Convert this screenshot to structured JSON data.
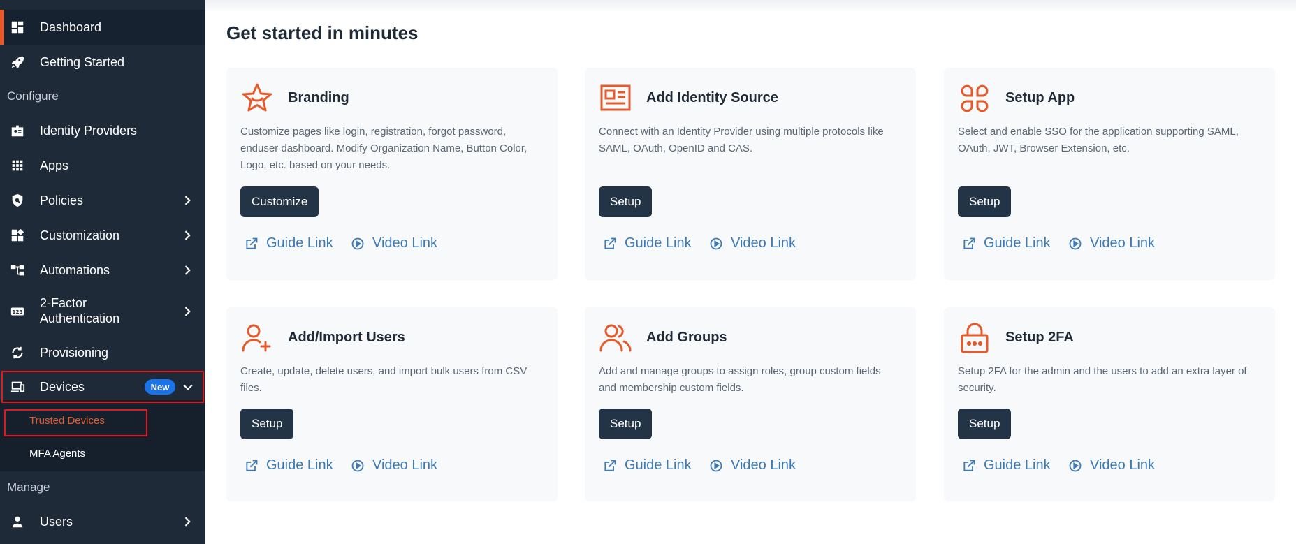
{
  "sidebar": {
    "dashboard": "Dashboard",
    "getting_started": "Getting Started",
    "section_configure": "Configure",
    "identity_providers": "Identity Providers",
    "apps": "Apps",
    "policies": "Policies",
    "customization": "Customization",
    "automations": "Automations",
    "two_factor_line1": "2-Factor",
    "two_factor_line2": "Authentication",
    "provisioning": "Provisioning",
    "devices": "Devices",
    "devices_badge": "New",
    "trusted_devices": "Trusted Devices",
    "mfa_agents": "MFA Agents",
    "section_manage": "Manage",
    "users": "Users"
  },
  "main": {
    "title": "Get started in minutes",
    "cards": [
      {
        "title": "Branding",
        "desc": "Customize pages like login, registration, forgot password, enduser dashboard. Modify Organization Name, Button Color, Logo, etc. based on your needs.",
        "button": "Customize",
        "guide": "Guide Link",
        "video": "Video Link"
      },
      {
        "title": "Add Identity Source",
        "desc": "Connect with an Identity Provider using multiple protocols like SAML, OAuth, OpenID and CAS.",
        "button": "Setup",
        "guide": "Guide Link",
        "video": "Video Link"
      },
      {
        "title": "Setup App",
        "desc": "Select and enable SSO for the application supporting SAML, OAuth, JWT, Browser Extension, etc.",
        "button": "Setup",
        "guide": "Guide Link",
        "video": "Video Link"
      },
      {
        "title": "Add/Import Users",
        "desc": "Create, update, delete users, and import bulk users from CSV files.",
        "button": "Setup",
        "guide": "Guide Link",
        "video": "Video Link"
      },
      {
        "title": "Add Groups",
        "desc": "Add and manage groups to assign roles, group custom fields and membership custom fields.",
        "button": "Setup",
        "guide": "Guide Link",
        "video": "Video Link"
      },
      {
        "title": "Setup 2FA",
        "desc": "Setup 2FA for the admin and the users to add an extra layer of security.",
        "button": "Setup",
        "guide": "Guide Link",
        "video": "Video Link"
      }
    ]
  },
  "colors": {
    "sidebar_bg": "#1e2a38",
    "accent": "#e8592a",
    "button_bg": "#243447",
    "link": "#3d7ab5",
    "badge": "#1a73e8",
    "highlight_box": "#e0191e"
  },
  "icons": {
    "dashboard": "dashboard-grid-icon",
    "getting_started": "rocket-icon",
    "identity_providers": "id-badge-icon",
    "apps": "apps-grid-icon",
    "policies": "shield-icon",
    "customization": "widgets-icon",
    "automations": "flow-icon",
    "two_factor": "123-pin-icon",
    "provisioning": "sync-icon",
    "devices": "devices-icon",
    "users": "user-icon",
    "branding": "star-smile-icon",
    "identity_source": "article-icon",
    "setup_app": "clover-icon",
    "import_users": "user-add-icon",
    "groups": "users-icon",
    "setup_2fa": "lock-icon",
    "guide": "external-link-icon",
    "video": "play-circle-icon"
  }
}
